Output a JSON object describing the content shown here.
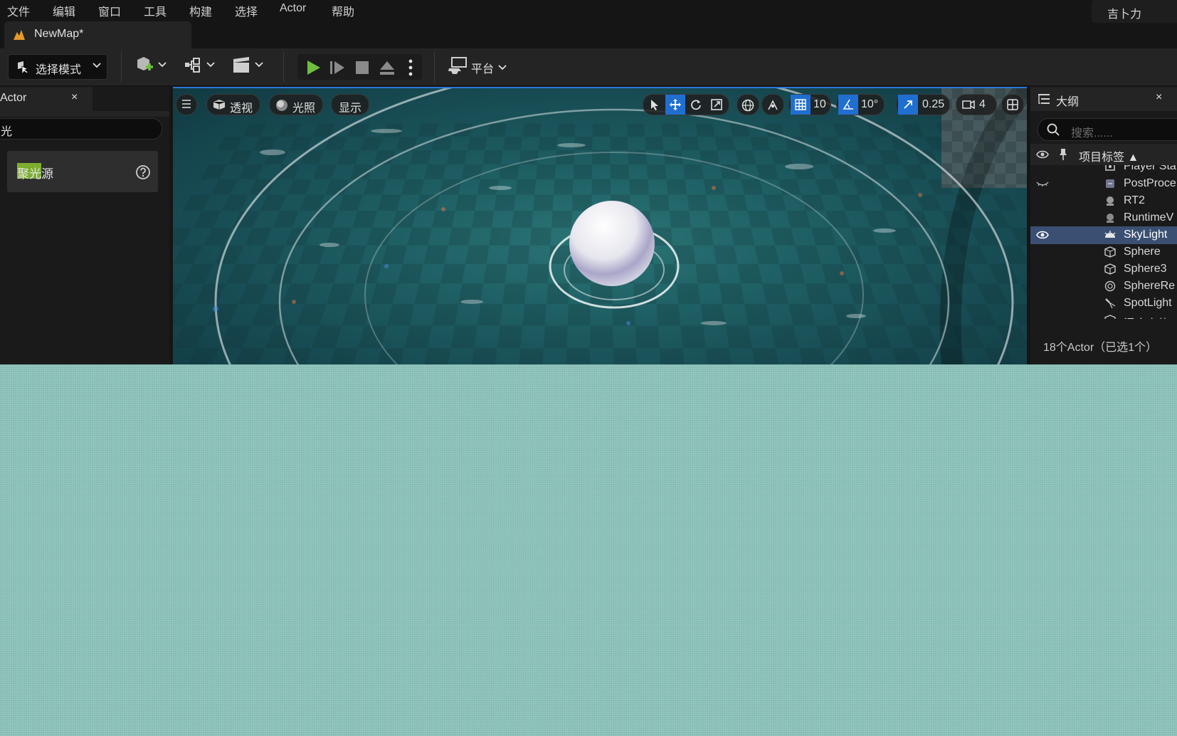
{
  "menu": {
    "items": [
      "文件",
      "编辑",
      "窗口",
      "工具",
      "构建",
      "选择",
      "Actor",
      "帮助"
    ],
    "user": "吉卜力"
  },
  "document_tab": {
    "label": "NewMap*"
  },
  "toolbar": {
    "mode_label": "选择模式",
    "platform_label": "平台",
    "play_color": "#6fbf3c"
  },
  "left_panel": {
    "tab_title": "Actor",
    "close": "×",
    "search_value": "光",
    "result_label": "聚光源",
    "result_highlight_color": "#7cae2f"
  },
  "viewport": {
    "perspective_label": "透视",
    "lighting_label": "光照",
    "show_label": "显示",
    "grid_snap": "10",
    "rotation_snap": "10°",
    "scale_snap": "0.25",
    "camera_speed": "4",
    "active_color": "#1f6fd1"
  },
  "outliner": {
    "tab_title": "大纲",
    "close": "×",
    "search_placeholder": "搜索......",
    "column_header": "项目标签 ▲",
    "rows": [
      {
        "name": "Player Sta",
        "icon": "player-start-icon"
      },
      {
        "name": "PostProce",
        "icon": "post-process-icon"
      },
      {
        "name": "RT2",
        "icon": "render-target-icon"
      },
      {
        "name": "RuntimeV",
        "icon": "runtime-virtual-texture-icon"
      },
      {
        "name": "SkyLight",
        "icon": "sky-light-icon",
        "selected": true
      },
      {
        "name": "Sphere",
        "icon": "static-mesh-icon"
      },
      {
        "name": "Sphere3",
        "icon": "static-mesh-icon"
      },
      {
        "name": "SphereRe",
        "icon": "sphere-reflection-icon"
      },
      {
        "name": "SpotLight",
        "icon": "spot-light-icon"
      },
      {
        "name": "混合立体",
        "icon": "volume-icon"
      }
    ],
    "footer": "18个Actor（已选1个）",
    "selected_color": "#3a4f72"
  }
}
